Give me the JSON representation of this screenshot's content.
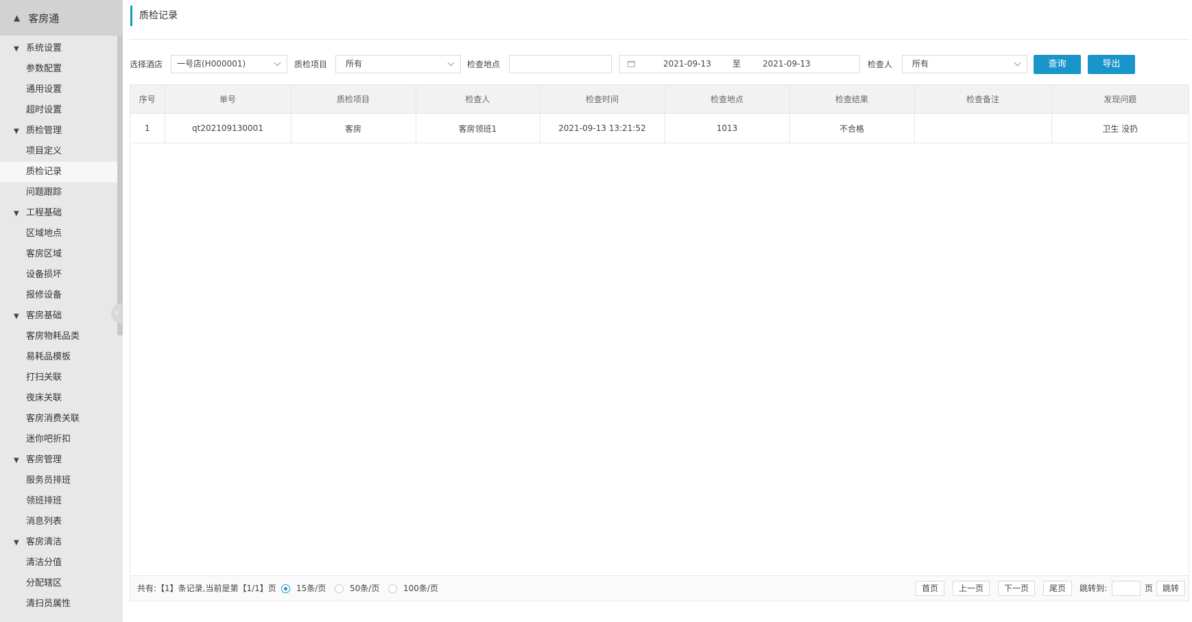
{
  "app": {
    "title": "客房通",
    "home_icon": "home-icon"
  },
  "sidebar": {
    "groups": [
      {
        "label": "系统设置",
        "items": [
          "参数配置",
          "通用设置",
          "超时设置"
        ]
      },
      {
        "label": "质检管理",
        "items": [
          "项目定义",
          "质检记录",
          "问题跟踪"
        ]
      },
      {
        "label": "工程基础",
        "items": [
          "区域地点",
          "客房区域",
          "设备损坏",
          "报修设备"
        ]
      },
      {
        "label": "客房基础",
        "items": [
          "客房物耗品类",
          "易耗品模板",
          "打扫关联",
          "夜床关联",
          "客房消费关联",
          "迷你吧折扣"
        ]
      },
      {
        "label": "客房管理",
        "items": [
          "服务员排班",
          "领班排班",
          "消息列表"
        ]
      },
      {
        "label": "客房清洁",
        "items": [
          "清洁分值",
          "分配辖区",
          "清扫员属性"
        ]
      }
    ],
    "active_item": "质检记录"
  },
  "page": {
    "title": "质检记录"
  },
  "filters": {
    "hotel_label": "选择酒店",
    "hotel_value": "一号店(H000001)",
    "item_label": "质检项目",
    "item_value": "所有",
    "location_label": "检查地点",
    "location_value": "",
    "date_from": "2021-09-13",
    "date_sep": "至",
    "date_to": "2021-09-13",
    "inspector_label": "检查人",
    "inspector_value": "所有",
    "query_button": "查询",
    "export_button": "导出"
  },
  "table": {
    "columns": [
      "序号",
      "单号",
      "质检项目",
      "检查人",
      "检查时间",
      "检查地点",
      "检查结果",
      "检查备注",
      "发现问题"
    ],
    "rows": [
      [
        "1",
        "qt202109130001",
        "客房",
        "客房领班1",
        "2021-09-13 13:21:52",
        "1013",
        "不合格",
        "",
        "卫生 没扔"
      ]
    ]
  },
  "pager": {
    "summary": "共有:【1】条记录,当前是第【1/1】页",
    "page_sizes": [
      "15条/页",
      "50条/页",
      "100条/页"
    ],
    "selected_size": "15条/页",
    "first": "首页",
    "prev": "上一页",
    "next": "下一页",
    "last": "尾页",
    "jump_label": "跳转到:",
    "jump_value": "",
    "page_unit": "页",
    "jump_button": "跳转"
  },
  "colors": {
    "accent": "#1a95c9",
    "sidebar_bg": "#e8e8e8",
    "sidebar_header": "#d2d2d2"
  }
}
